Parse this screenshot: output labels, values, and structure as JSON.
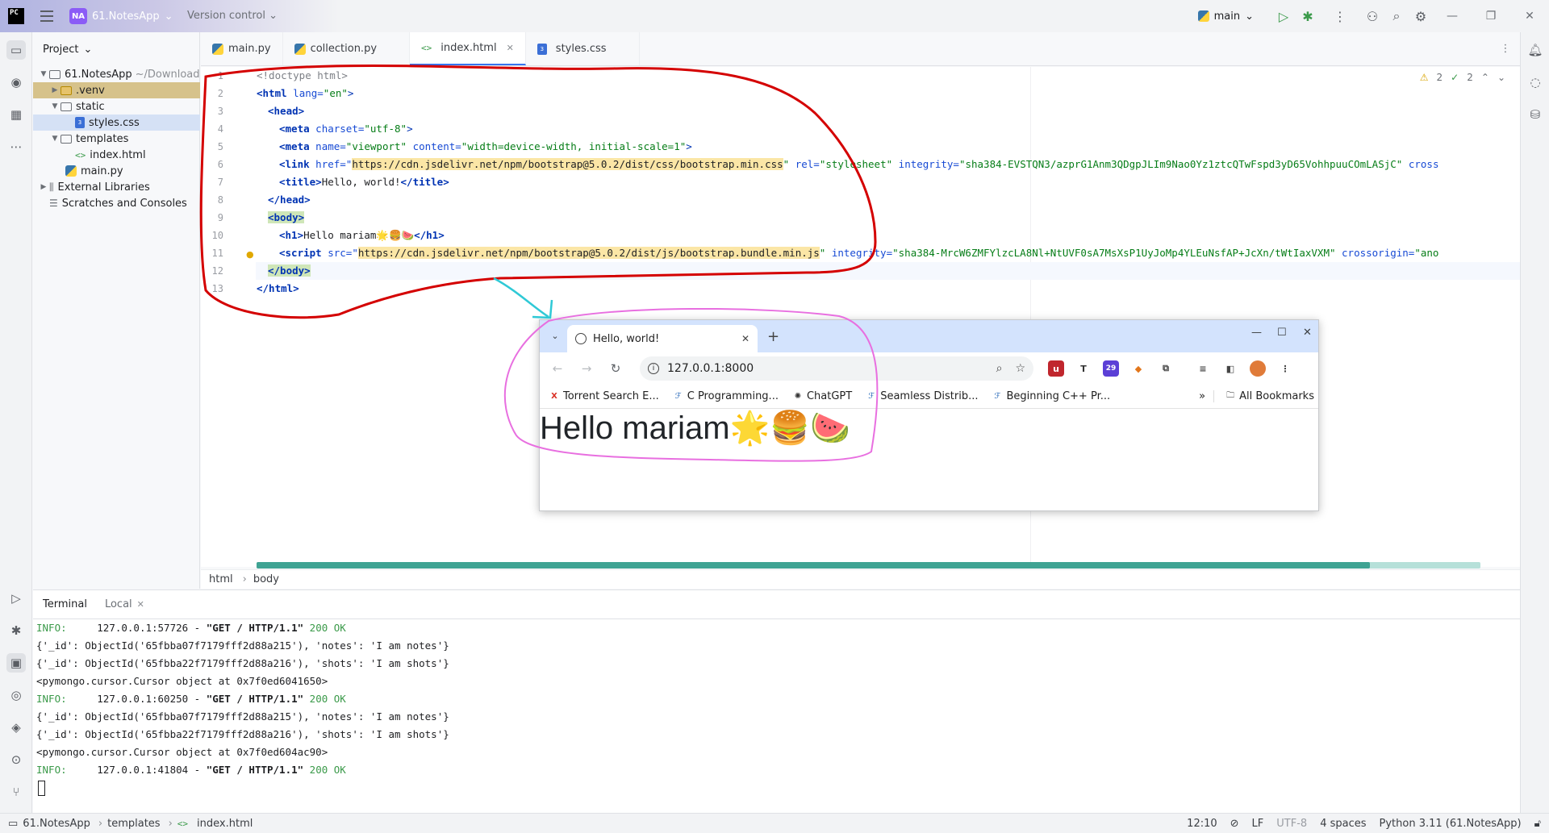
{
  "titlebar": {
    "app_logo": "PC",
    "project_badge": "NA",
    "project_name": "61.NotesApp",
    "vcs_label": "Version control",
    "branch": "main"
  },
  "project_panel": {
    "header": "Project",
    "root_name": "61.NotesApp",
    "root_path": "~/Download",
    "items": [
      {
        "label": ".venv"
      },
      {
        "label": "static"
      },
      {
        "label": "styles.css"
      },
      {
        "label": "templates"
      },
      {
        "label": "index.html"
      },
      {
        "label": "main.py"
      },
      {
        "label": "External Libraries"
      },
      {
        "label": "Scratches and Consoles"
      }
    ]
  },
  "tabs": [
    {
      "label": "main.py"
    },
    {
      "label": "collection.py"
    },
    {
      "label": "index.html"
    },
    {
      "label": "styles.css"
    }
  ],
  "inspections": {
    "warnings": "2",
    "ok": "2"
  },
  "code": {
    "l1": "<!doctype html>",
    "l2_tag": "<html",
    "l2_attr": " lang=",
    "l2_val": "\"en\"",
    "l2_end": ">",
    "l3": "<head>",
    "l4_a": "<meta",
    "l4_b": " charset=",
    "l4_c": "\"utf-8\"",
    "l4_d": ">",
    "l5_a": "<meta",
    "l5_b": " name=",
    "l5_c": "\"viewport\"",
    "l5_d": " content=",
    "l5_e": "\"width=device-width, initial-scale=1\"",
    "l5_f": ">",
    "l6_a": "<link",
    "l6_b": " href=\"",
    "l6_url": "https://cdn.jsdelivr.net/npm/bootstrap@5.0.2/dist/css/bootstrap.min.css",
    "l6_c": "\"",
    "l6_d": " rel=",
    "l6_e": "\"stylesheet\"",
    "l6_f": " integrity=",
    "l6_g": "\"sha384-EVSTQN3/azprG1Anm3QDgpJLIm9Nao0Yz1ztcQTwFspd3yD65VohhpuuCOmLASjC\"",
    "l6_h": " cross",
    "l7_a": "<title>",
    "l7_b": "Hello, world!",
    "l7_c": "</title>",
    "l8": "</head>",
    "l9": "<body>",
    "l10_a": "<h1>",
    "l10_b": "Hello mariam🌟🍔🍉",
    "l10_c": "</h1>",
    "l11_a": "<script",
    "l11_b": " src=\"",
    "l11_url": "https://cdn.jsdelivr.net/npm/bootstrap@5.0.2/dist/js/bootstrap.bundle.min.js",
    "l11_c": "\"",
    "l11_d": " integrity=",
    "l11_e": "\"sha384-MrcW6ZMFYlzcLA8Nl+NtUVF0sA7MsXsP1UyJoMp4YLEuNsfAP+JcXn/tWtIaxVXM\"",
    "l11_f": " crossorigin=",
    "l11_g": "\"ano",
    "l12": "</body>",
    "l13": "</html>"
  },
  "line_numbers": [
    "1",
    "2",
    "3",
    "4",
    "5",
    "6",
    "7",
    "8",
    "9",
    "10",
    "11",
    "12",
    "13"
  ],
  "breadcrumb": [
    "html",
    "body"
  ],
  "browser": {
    "tab_title": "Hello, world!",
    "url": "127.0.0.1:8000",
    "extension_badge": "29",
    "bookmarks": [
      "Torrent Search E...",
      "C Programming...",
      "ChatGPT",
      "Seamless Distrib...",
      "Beginning C++ Pr..."
    ],
    "all_bookmarks": "All Bookmarks",
    "heading": "Hello mariam🌟🍔🍉"
  },
  "terminal": {
    "tab_terminal": "Terminal",
    "tab_local": "Local",
    "lines": [
      {
        "kw": "INFO:",
        "addr": "     127.0.0.1:57726 - ",
        "req": "\"GET / HTTP/1.1\"",
        "status": " 200 OK"
      },
      {
        "text": "{'_id': ObjectId('65fbba07f7179fff2d88a215'), 'notes': 'I am notes'}"
      },
      {
        "text": "{'_id': ObjectId('65fbba22f7179fff2d88a216'), 'shots': 'I am shots'}"
      },
      {
        "text": "<pymongo.cursor.Cursor object at 0x7f0ed6041650>"
      },
      {
        "kw": "INFO:",
        "addr": "     127.0.0.1:60250 - ",
        "req": "\"GET / HTTP/1.1\"",
        "status": " 200 OK"
      },
      {
        "text": "{'_id': ObjectId('65fbba07f7179fff2d88a215'), 'notes': 'I am notes'}"
      },
      {
        "text": "{'_id': ObjectId('65fbba22f7179fff2d88a216'), 'shots': 'I am shots'}"
      },
      {
        "text": "<pymongo.cursor.Cursor object at 0x7f0ed604ac90>"
      },
      {
        "kw": "INFO:",
        "addr": "     127.0.0.1:41804 - ",
        "req": "\"GET / HTTP/1.1\"",
        "status": " 200 OK"
      }
    ]
  },
  "statusbar": {
    "crumbs": [
      "61.NotesApp",
      "templates",
      "index.html"
    ],
    "position": "12:10",
    "line_sep": "LF",
    "encoding": "UTF-8",
    "indent": "4 spaces",
    "interpreter": "Python 3.11 (61.NotesApp)"
  },
  "colors": {
    "annotation_red": "#d40000",
    "annotation_magenta": "#e86fe0",
    "annotation_cyan": "#2fc9d6",
    "accent": "#3574f0"
  }
}
